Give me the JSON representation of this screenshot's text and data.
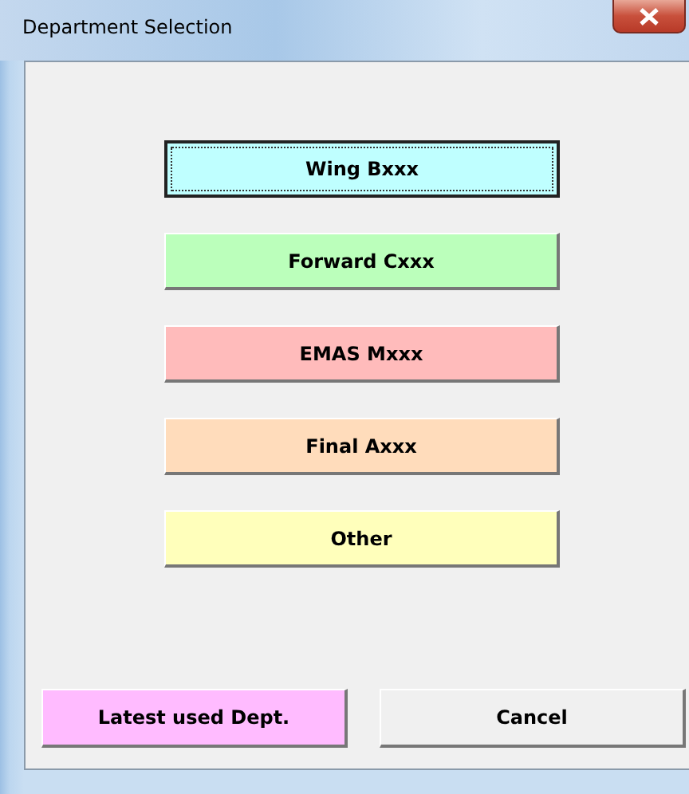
{
  "window": {
    "title": "Department Selection"
  },
  "department_buttons": [
    {
      "label": "Wing Bxxx",
      "color": "#bfffff",
      "focused": true
    },
    {
      "label": "Forward Cxxx",
      "color": "#bbffbb",
      "focused": false
    },
    {
      "label": "EMAS Mxxx",
      "color": "#ffbbbb",
      "focused": false
    },
    {
      "label": "Final Axxx",
      "color": "#ffdcbb",
      "focused": false
    },
    {
      "label": "Other",
      "color": "#ffffbb",
      "focused": false
    }
  ],
  "bottom_buttons": [
    {
      "label": "Latest used Dept.",
      "color": "#ffbbff"
    },
    {
      "label": "Cancel",
      "color": "#f0f0f0"
    }
  ]
}
